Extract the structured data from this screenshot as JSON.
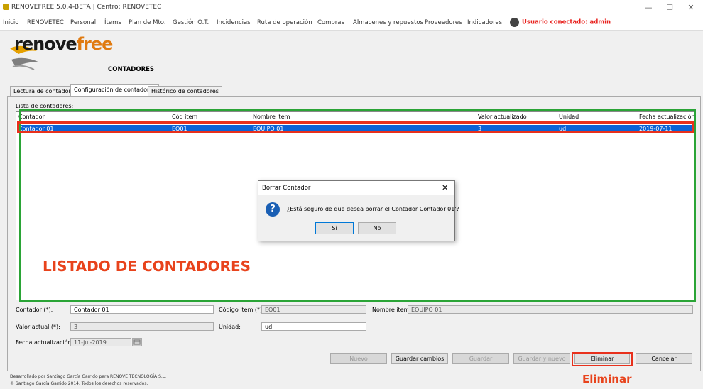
{
  "window": {
    "title": "RENOVEFREE 5.0.4-BETA | Centro: RENOVETEC",
    "minimize": "—",
    "maximize": "☐",
    "close": "✕"
  },
  "menu": [
    "Inicio",
    "RENOVETEC",
    "Personal",
    "Ítems",
    "Plan de Mto.",
    "Gestión O.T.",
    "Incidencias",
    "Ruta de operación",
    "Compras",
    "Almacenes y repuestos",
    "Proveedores",
    "Indicadores"
  ],
  "user": {
    "label": "Usuario conectado: admin"
  },
  "logo": {
    "pre": "renove",
    "post": "free"
  },
  "section_title": "CONTADORES",
  "tabs": [
    "Lectura de contadores",
    "Configuración de contadores",
    "Histórico de contadores"
  ],
  "list": {
    "label": "Lista de contadores:",
    "columns": [
      "Contador",
      "Cód ítem",
      "Nombre ítem",
      "Valor actualizado",
      "Unidad",
      "Fecha actualización"
    ],
    "rows": [
      [
        "Contador 01",
        "EQ01",
        "EQUIPO 01",
        "3",
        "ud",
        "2019-07-11"
      ]
    ]
  },
  "annotation_list": "LISTADO DE CONTADORES",
  "annotation_delete": "Eliminar",
  "dialog": {
    "title": "Borrar Contador",
    "close": "✕",
    "icon": "?",
    "message": "¿Está seguro de que desea borrar el Contador Contador 01'?",
    "yes": "Sí",
    "no": "No"
  },
  "form": {
    "contador_label": "Contador (*):",
    "contador_value": "Contador 01",
    "codigo_label": "Código ítem (*):",
    "codigo_value": "EQ01",
    "nombre_label": "Nombre ítem:",
    "nombre_value": "EQUIPO 01",
    "valor_label": "Valor actual (*):",
    "valor_value": "3",
    "unidad_label": "Unidad:",
    "unidad_value": "ud",
    "fecha_label": "Fecha actualización:",
    "fecha_value": "11-jul-2019"
  },
  "buttons": {
    "nuevo": "Nuevo",
    "guardar_cambios": "Guardar cambios",
    "guardar": "Guardar",
    "guardar_nuevo": "Guardar y nuevo",
    "eliminar": "Eliminar",
    "cancelar": "Cancelar"
  },
  "footer": [
    "Desarrollado por Santiago García Garrido para RENOVE TECNOLOGÍA S.L.",
    "© Santiago García Garrido 2014. Todos los derechos reservados."
  ],
  "colors": {
    "selection": "#0a63d6",
    "annotation": "#e8431c",
    "highlight_green": "#2aa436",
    "user": "#e8201c"
  }
}
